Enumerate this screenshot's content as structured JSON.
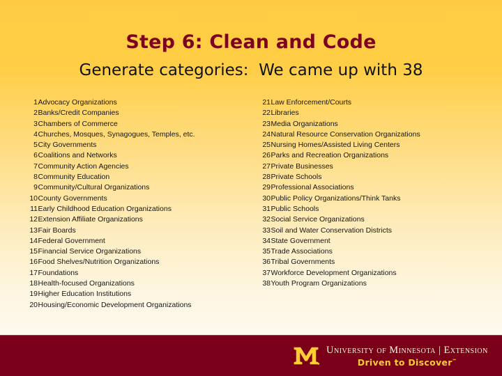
{
  "slide": {
    "title": "Step 6: Clean and Code",
    "subtitle": "Generate categories:  We came up with 38",
    "title_color": "#7d0320",
    "subtitle_color": "#121212",
    "background_top_color": "#ffcc41",
    "background_bottom_color": "#fdf8ec"
  },
  "categories": {
    "left": [
      {
        "num": "1",
        "label": "Advocacy Organizations"
      },
      {
        "num": "2",
        "label": "Banks/Credit Companies"
      },
      {
        "num": "3",
        "label": "Chambers of Commerce"
      },
      {
        "num": "4",
        "label": "Churches, Mosques, Synagogues, Temples, etc."
      },
      {
        "num": "5",
        "label": "City Governments"
      },
      {
        "num": "6",
        "label": "Coalitions and Networks"
      },
      {
        "num": "7",
        "label": "Community Action Agencies"
      },
      {
        "num": "8",
        "label": "Community Education"
      },
      {
        "num": "9",
        "label": "Community/Cultural Organizations"
      },
      {
        "num": "10",
        "label": "County Governments"
      },
      {
        "num": "11",
        "label": "Early Childhood Education Organizations"
      },
      {
        "num": "12",
        "label": "Extension Affiliate Organizations"
      },
      {
        "num": "13",
        "label": "Fair Boards"
      },
      {
        "num": "14",
        "label": "Federal Government"
      },
      {
        "num": "15",
        "label": "Financial Service Organizations"
      },
      {
        "num": "16",
        "label": "Food Shelves/Nutrition Organizations"
      },
      {
        "num": "17",
        "label": "Foundations"
      },
      {
        "num": "18",
        "label": "Health-focused Organizations"
      },
      {
        "num": "19",
        "label": "Higher Education Institutions"
      },
      {
        "num": "20",
        "label": "Housing/Economic Development Organizations"
      }
    ],
    "right": [
      {
        "num": "21",
        "label": "Law Enforcement/Courts"
      },
      {
        "num": "22",
        "label": "Libraries"
      },
      {
        "num": "23",
        "label": "Media Organizations"
      },
      {
        "num": "24",
        "label": "Natural Resource Conservation Organizations"
      },
      {
        "num": "25",
        "label": "Nursing Homes/Assisted Living Centers"
      },
      {
        "num": "26",
        "label": "Parks and Recreation Organizations"
      },
      {
        "num": "27",
        "label": "Private Businesses"
      },
      {
        "num": "28",
        "label": "Private Schools"
      },
      {
        "num": "29",
        "label": "Professional Associations"
      },
      {
        "num": "30",
        "label": "Public Policy Organizations/Think Tanks"
      },
      {
        "num": "31",
        "label": "Public Schools"
      },
      {
        "num": "32",
        "label": "Social Service Organizations"
      },
      {
        "num": "33",
        "label": "Soil and Water Conservation Districts"
      },
      {
        "num": "34",
        "label": "State Government"
      },
      {
        "num": "35",
        "label": "Trade Associations"
      },
      {
        "num": "36",
        "label": "Tribal Governments"
      },
      {
        "num": "37",
        "label": "Workforce Development Organizations"
      },
      {
        "num": "38",
        "label": "Youth Program Organizations"
      }
    ]
  },
  "footer": {
    "logo_icon": "block-m-icon",
    "institution": "University of Minnesota | Extension",
    "tagline": "Driven to Discover",
    "tagline_mark": "℠",
    "bar_color": "#7a0019",
    "gold_color": "#ffcc33"
  }
}
